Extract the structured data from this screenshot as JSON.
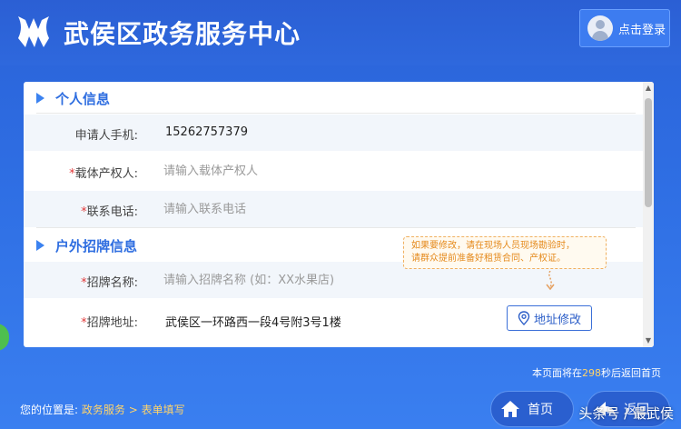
{
  "header": {
    "title": "武侯区政务服务中心",
    "login_label": "点击登录"
  },
  "sections": {
    "personal": {
      "title": "个人信息",
      "phone_label": "申请人手机:",
      "phone_value": "15262757379",
      "owner_label": "载体产权人:",
      "owner_placeholder": "请输入载体产权人",
      "contact_label": "联系电话:",
      "contact_placeholder": "请输入联系电话"
    },
    "sign": {
      "title": "户外招牌信息",
      "name_label": "招牌名称:",
      "name_placeholder": "请输入招牌名称 (如：XX水果店)",
      "address_label": "招牌地址:",
      "address_value": "武侯区一环路西一段4号附3号1楼",
      "address_button": "地址修改",
      "tip_line1": "如果要修改，请在现场人员现场勘验时，",
      "tip_line2": "请群众提前准备好租赁合同、产权证。"
    }
  },
  "required_mark": "*",
  "footer": {
    "countdown_prefix": "本页面将在",
    "countdown_seconds": "298",
    "countdown_suffix": "秒后返回首页",
    "breadcrumb_label": "您的位置是:",
    "breadcrumb_item1": "政务服务",
    "breadcrumb_sep": ">",
    "breadcrumb_item2": "表单填写",
    "home_label": "首页",
    "back_label": "返回"
  },
  "watermark": "头条号 / 最武侯",
  "colors": {
    "accent": "#2f6ee0",
    "required": "#e23a3a",
    "tip": "#e58a1c",
    "highlight": "#ffd46b"
  },
  "icons": [
    "logo-icon",
    "avatar-icon",
    "section-arrow-icon",
    "location-pin-icon",
    "home-icon",
    "back-icon"
  ]
}
